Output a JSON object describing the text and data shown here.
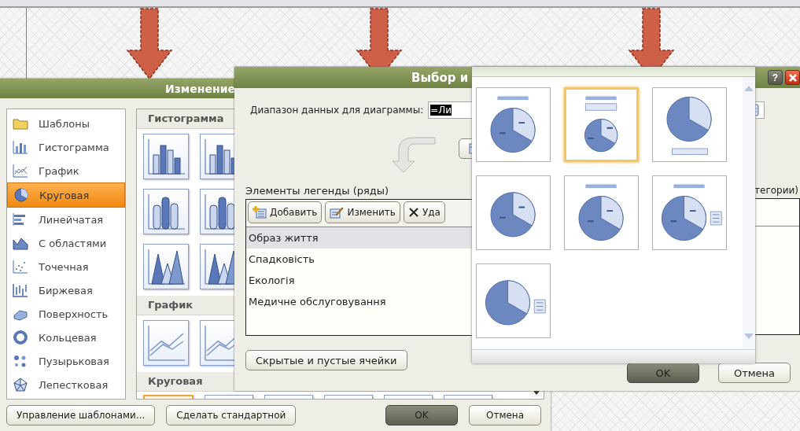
{
  "change_type_dialog": {
    "title": "Изменение",
    "chart_types": [
      {
        "label": "Шаблоны",
        "selected": false
      },
      {
        "label": "Гистограмма",
        "selected": false
      },
      {
        "label": "График",
        "selected": false
      },
      {
        "label": "Круговая",
        "selected": true
      },
      {
        "label": "Линейчатая",
        "selected": false
      },
      {
        "label": "С областями",
        "selected": false
      },
      {
        "label": "Точечная",
        "selected": false
      },
      {
        "label": "Биржевая",
        "selected": false
      },
      {
        "label": "Поверхность",
        "selected": false
      },
      {
        "label": "Кольцевая",
        "selected": false
      },
      {
        "label": "Пузырьковая",
        "selected": false
      },
      {
        "label": "Лепестковая",
        "selected": false
      }
    ],
    "gallery_sections": [
      {
        "title": "Гистограмма",
        "kind": "column",
        "thumbnails": [
          {
            "selected": false
          },
          {
            "selected": false
          },
          {
            "selected": false
          },
          {
            "selected": false
          },
          {
            "selected": false
          },
          {
            "selected": false
          }
        ]
      },
      {
        "title": "График",
        "kind": "line",
        "thumbnails": [
          {
            "selected": false
          },
          {
            "selected": false
          }
        ]
      },
      {
        "title": "Круговая",
        "kind": "pie",
        "thumbnails": [
          {
            "selected": true
          },
          {
            "selected": false
          },
          {
            "selected": false
          },
          {
            "selected": false
          },
          {
            "selected": false
          },
          {
            "selected": false
          }
        ]
      }
    ],
    "left_buttons": [
      "Управление шаблонами...",
      "Сделать стандартной"
    ],
    "right_buttons": [
      {
        "label": "OK",
        "default": true
      },
      {
        "label": "Отмена",
        "default": false
      }
    ]
  },
  "source_dialog": {
    "title": "Выбор и",
    "help_button": "?",
    "range_label": "Диапазон данных для диаграммы:",
    "range_value": "=Ли",
    "legend_label": "Элементы легенды (ряды)",
    "legend_actions": [
      {
        "label": "Добавить",
        "kind": "add"
      },
      {
        "label": "Изменить",
        "kind": "edit"
      },
      {
        "label": "Уда",
        "kind": "delete"
      }
    ],
    "series": [
      {
        "label": "Образ життя",
        "selected": true
      },
      {
        "label": "Спадковість",
        "selected": false
      },
      {
        "label": "Екологія",
        "selected": false
      },
      {
        "label": "Медичне обслуговування",
        "selected": false
      }
    ],
    "categories_label": "тегории)",
    "hidden_cells_button": "Скрытые и пустые ячейки",
    "right_buttons": [
      {
        "label": "OK",
        "default": true
      },
      {
        "label": "Отмена",
        "default": false
      }
    ]
  },
  "layout_gallery": {
    "layouts": [
      {
        "selected": false
      },
      {
        "selected": true
      },
      {
        "selected": false
      },
      {
        "selected": false
      },
      {
        "selected": false
      },
      {
        "selected": false
      },
      {
        "selected": false
      }
    ]
  }
}
